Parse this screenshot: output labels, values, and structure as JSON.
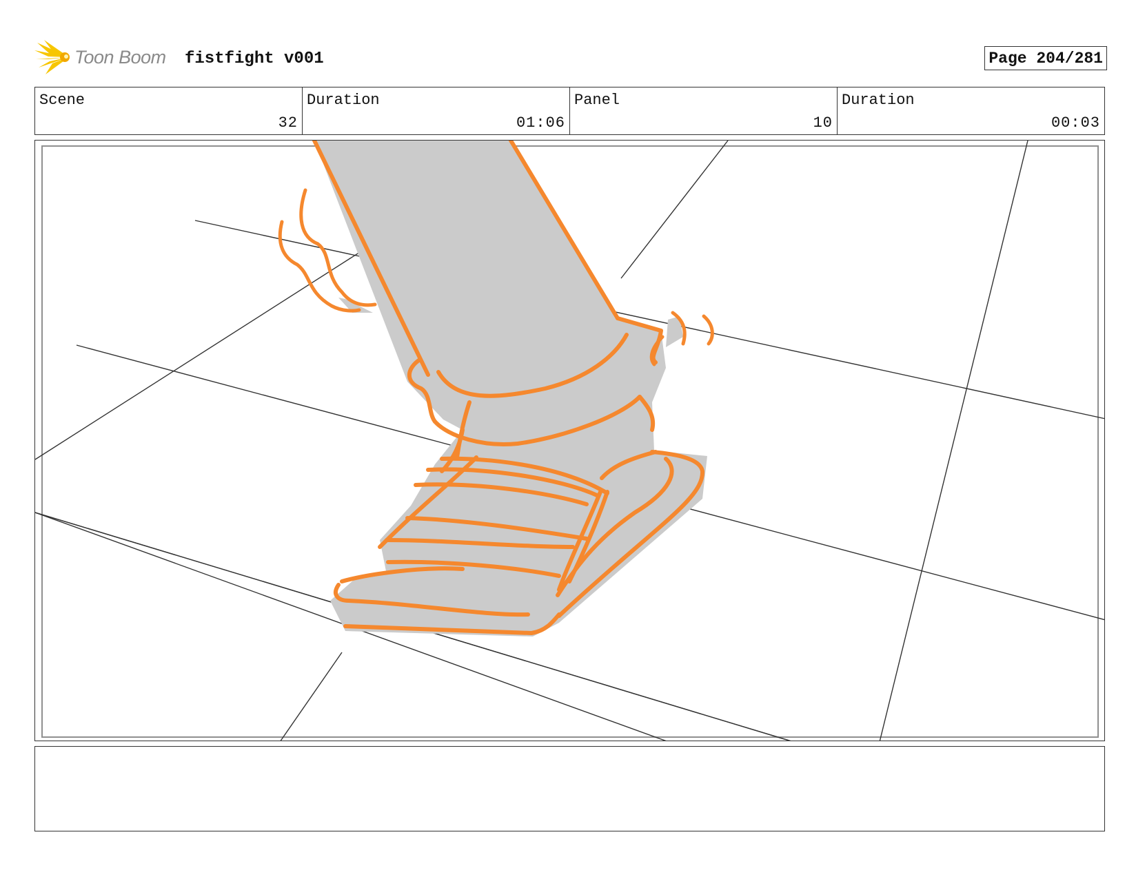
{
  "header": {
    "brand": "Toon Boom",
    "brand_icon": "starburst-logo-icon",
    "project_title": "fistfight v001",
    "page_counter": "Page 204/281"
  },
  "info": {
    "scene_label": "Scene",
    "scene_value": "32",
    "scene_duration_label": "Duration",
    "scene_duration_value": "01:06",
    "panel_label": "Panel",
    "panel_value": "10",
    "panel_duration_label": "Duration",
    "panel_duration_value": "00:03"
  },
  "colors": {
    "stroke": "#f5882e",
    "fill": "#cbcbcb",
    "grid": "#333333",
    "logo": "#f7c600"
  },
  "notes": {
    "text": ""
  }
}
